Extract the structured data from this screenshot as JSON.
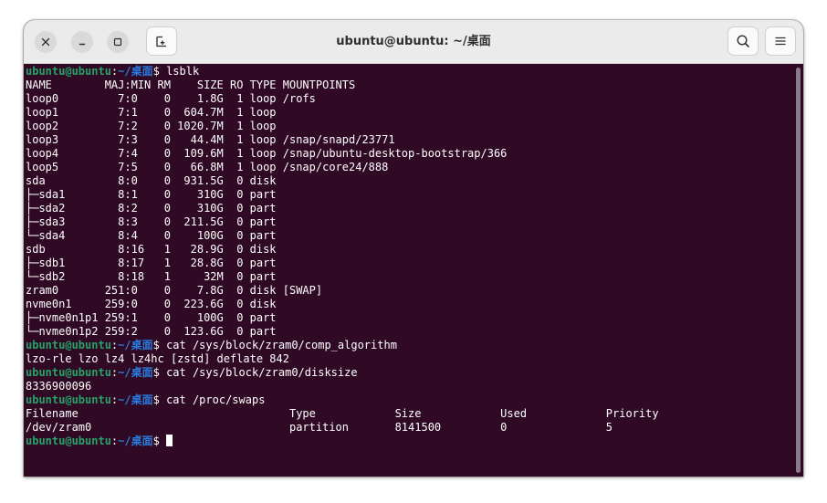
{
  "window": {
    "title": "ubuntu@ubuntu: ~/桌面"
  },
  "icons": {
    "close": "close-icon",
    "minimize": "minimize-icon",
    "maximize": "maximize-icon",
    "new_tab": "new-tab-icon",
    "search": "search-icon",
    "menu": "hamburger-menu-icon"
  },
  "colors": {
    "terminal_background": "#300a24",
    "prompt_user": "#26a269",
    "prompt_path": "#2a7bde",
    "text": "#ffffff",
    "titlebar": "#ebebeb"
  },
  "terminal": {
    "lines": [
      {
        "user": "ubuntu@ubuntu",
        "path": "~/桌面",
        "cmd": "lsblk"
      },
      {
        "text": "NAME        MAJ:MIN RM    SIZE RO TYPE MOUNTPOINTS"
      },
      {
        "text": "loop0         7:0    0    1.8G  1 loop /rofs"
      },
      {
        "text": "loop1         7:1    0  604.7M  1 loop"
      },
      {
        "text": "loop2         7:2    0 1020.7M  1 loop"
      },
      {
        "text": "loop3         7:3    0   44.4M  1 loop /snap/snapd/23771"
      },
      {
        "text": "loop4         7:4    0  109.6M  1 loop /snap/ubuntu-desktop-bootstrap/366"
      },
      {
        "text": "loop5         7:5    0   66.8M  1 loop /snap/core24/888"
      },
      {
        "text": "sda           8:0    0  931.5G  0 disk"
      },
      {
        "text": "├─sda1        8:1    0    310G  0 part"
      },
      {
        "text": "├─sda2        8:2    0    310G  0 part"
      },
      {
        "text": "├─sda3        8:3    0  211.5G  0 part"
      },
      {
        "text": "└─sda4        8:4    0    100G  0 part"
      },
      {
        "text": "sdb           8:16   1   28.9G  0 disk"
      },
      {
        "text": "├─sdb1        8:17   1   28.8G  0 part"
      },
      {
        "text": "└─sdb2        8:18   1     32M  0 part"
      },
      {
        "text": "zram0       251:0    0    7.8G  0 disk [SWAP]"
      },
      {
        "text": "nvme0n1     259:0    0  223.6G  0 disk"
      },
      {
        "text": "├─nvme0n1p1 259:1    0    100G  0 part"
      },
      {
        "text": "└─nvme0n1p2 259:2    0  123.6G  0 part"
      },
      {
        "user": "ubuntu@ubuntu",
        "path": "~/桌面",
        "cmd": "cat /sys/block/zram0/comp_algorithm"
      },
      {
        "text": "lzo-rle lzo lz4 lz4hc [zstd] deflate 842"
      },
      {
        "user": "ubuntu@ubuntu",
        "path": "~/桌面",
        "cmd": "cat /sys/block/zram0/disksize"
      },
      {
        "text": "8336900096"
      },
      {
        "user": "ubuntu@ubuntu",
        "path": "~/桌面",
        "cmd": "cat /proc/swaps"
      },
      {
        "text": "Filename                                Type            Size            Used            Priority"
      },
      {
        "text": "/dev/zram0                              partition       8141500         0               5"
      },
      {
        "user": "ubuntu@ubuntu",
        "path": "~/桌面",
        "cmd": "",
        "cursor": true
      }
    ]
  }
}
